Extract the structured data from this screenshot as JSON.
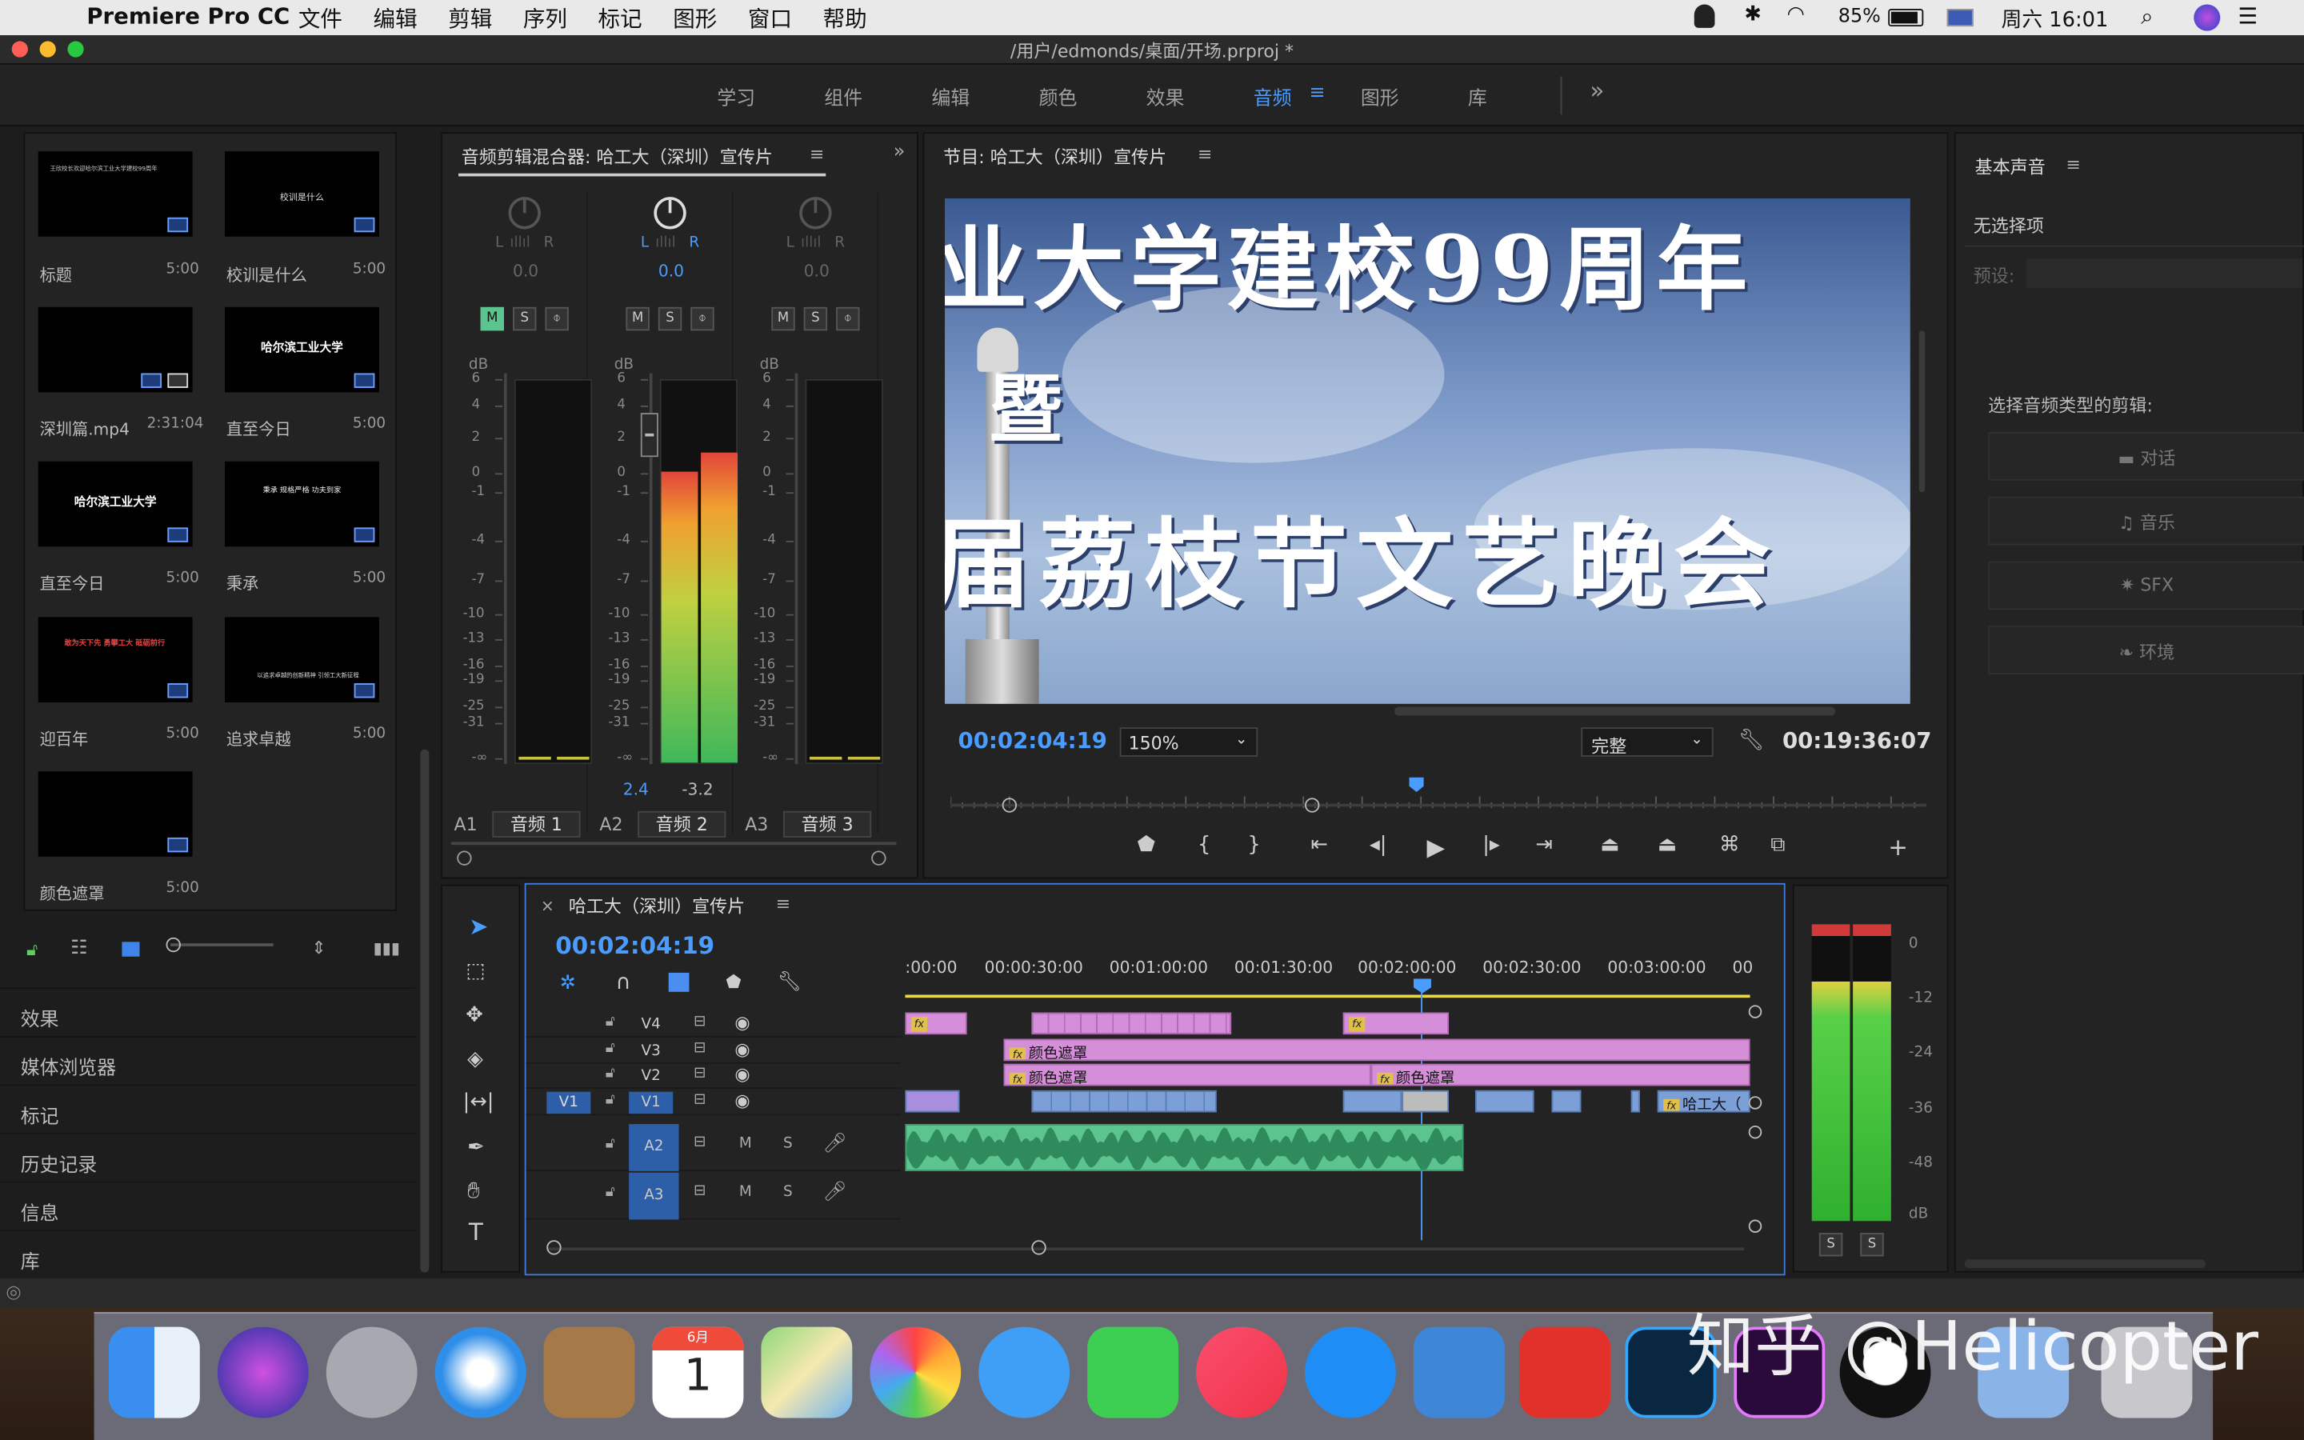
{
  "menubar": {
    "app": "Premiere Pro CC",
    "items": [
      "文件",
      "编辑",
      "剪辑",
      "序列",
      "标记",
      "图形",
      "窗口",
      "帮助"
    ],
    "battery": "85%",
    "clock": "周六 16:01"
  },
  "window": {
    "title": "/用户/edmonds/桌面/开场.prproj *"
  },
  "workspaces": {
    "items": [
      "学习",
      "组件",
      "编辑",
      "颜色",
      "效果",
      "音频",
      "图形",
      "库"
    ],
    "active": "音频",
    "more": "»"
  },
  "project": {
    "items": [
      {
        "name": "标题",
        "dur": "5:00",
        "thumb": "title-card"
      },
      {
        "name": "校训是什么",
        "dur": "5:00",
        "thumb": "text-card"
      },
      {
        "name": "深圳篇.mp4",
        "dur": "2:31:04",
        "thumb": "black"
      },
      {
        "name": "直至今日",
        "dur": "5:00",
        "thumb": "text-card"
      },
      {
        "name": "直至今日",
        "dur": "5:00",
        "thumb": "text-card"
      },
      {
        "name": "秉承",
        "dur": "5:00",
        "thumb": "text-card"
      },
      {
        "name": "迎百年",
        "dur": "5:00",
        "thumb": "red-text-card"
      },
      {
        "name": "追求卓越",
        "dur": "5:00",
        "thumb": "text-card"
      },
      {
        "name": "颜色遮罩",
        "dur": "5:00",
        "thumb": "black"
      }
    ],
    "thumb_text": {
      "t1": "王欣校长欢迎哈尔滨工业大学建校99周年",
      "t2": "校训是什么",
      "t4": "哈尔滨工业大学",
      "t5": "哈尔滨工业大学",
      "t6": "秉承 规格严格 功夫到家",
      "t7": "敢为天下先 勇攀工大 砥砺前行",
      "t8": "以追求卓越的创新精神 引领工大新征程"
    }
  },
  "nav": {
    "items": [
      "效果",
      "媒体浏览器",
      "标记",
      "历史记录",
      "信息",
      "库"
    ]
  },
  "mixer": {
    "title": "音频剪辑混合器: 哈工大（深圳）宣传片",
    "channels": [
      {
        "id": "A1",
        "name": "音频 1",
        "pan": "0.0",
        "L": "L",
        "R": "R",
        "peakL": "",
        "peakR": "",
        "levelL": 0,
        "levelR": 0
      },
      {
        "id": "A2",
        "name": "音频 2",
        "pan": "0.0",
        "L": "L",
        "R": "R",
        "peakL": "2.4",
        "peakR": "-3.2",
        "levelL": 0.76,
        "levelR": 0.81
      },
      {
        "id": "A3",
        "name": "音频 3",
        "pan": "0.0",
        "L": "L",
        "R": "R",
        "peakL": "",
        "peakR": "",
        "levelL": 0,
        "levelR": 0
      }
    ],
    "db_label": "dB",
    "scale": [
      "6",
      "4",
      "2",
      "0",
      "-1",
      "-4",
      "-7",
      "-10",
      "-13",
      "-16",
      "-19",
      "-25",
      "-31",
      "-∞"
    ],
    "buttons": [
      "M",
      "S",
      "⌽"
    ]
  },
  "program": {
    "title": "节目: 哈工大（深圳）宣传片",
    "frame_text": {
      "line1": "业大学建校99周年",
      "line2": "暨",
      "line3": "届荔枝节文艺晚会"
    },
    "timecode": "00:02:04:19",
    "zoom": "150%",
    "quality": "完整",
    "duration": "00:19:36:07",
    "playhead": 0.44
  },
  "essential_sound": {
    "title": "基本声音",
    "no_selection": "无选择项",
    "preset_label": "预设:",
    "prompt": "选择音频类型的剪辑:",
    "types": [
      "对话",
      "音乐",
      "SFX",
      "环境"
    ]
  },
  "timeline": {
    "title": "哈工大（深圳）宣传片",
    "timecode": "00:02:04:19",
    "ruler": [
      ":00:00",
      "00:00:30:00",
      "00:01:00:00",
      "00:01:30:00",
      "00:02:00:00",
      "00:02:30:00",
      "00:03:00:00",
      "00"
    ],
    "tracks": [
      {
        "name": "V4",
        "kind": "video"
      },
      {
        "name": "V3",
        "kind": "video"
      },
      {
        "name": "V2",
        "kind": "video"
      },
      {
        "name": "V1",
        "kind": "video",
        "source": "V1"
      },
      {
        "name": "A2",
        "kind": "audio",
        "M": "M",
        "S": "S"
      },
      {
        "name": "A3",
        "kind": "audio",
        "M": "M",
        "S": "S"
      }
    ],
    "clips": {
      "v3": "颜色遮罩",
      "v2a": "颜色遮罩",
      "v2b": "颜色遮罩",
      "v1_end": "哈工大（",
      "fx": "fx"
    }
  },
  "meter": {
    "scale": [
      "0",
      "-12",
      "-24",
      "-36",
      "-48",
      "dB"
    ],
    "solo": [
      "S",
      "S"
    ],
    "levelL": 0.84,
    "levelR": 0.84
  },
  "watermark": "知乎 @Helicopter",
  "dock": {
    "calendar_month": "6月",
    "calendar_day": "1"
  }
}
